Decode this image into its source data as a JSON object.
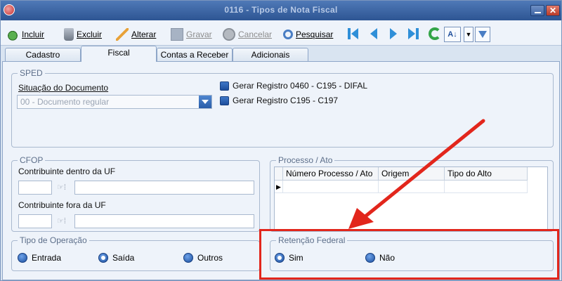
{
  "window": {
    "title": "0116 - Tipos de Nota Fiscal"
  },
  "toolbar": {
    "incluir": "Incluir",
    "excluir": "Excluir",
    "alterar": "Alterar",
    "gravar": "Gravar",
    "cancelar": "Cancelar",
    "pesquisar": "Pesquisar",
    "sort": "A↓"
  },
  "tabs": [
    "Cadastro",
    "Fiscal",
    "Contas a Receber",
    "Adicionais"
  ],
  "active_tab": "Fiscal",
  "sped": {
    "title": "SPED",
    "situacao_label": "Situação do Documento",
    "situacao_value": "00 - Documento regular",
    "check1": "Gerar Registro 0460 - C195 - DIFAL",
    "check2": "Gerar Registro C195 - C197"
  },
  "cfop": {
    "title": "CFOP",
    "dentro_label": "Contribuinte dentro da UF",
    "fora_label": "Contribuinte fora da UF"
  },
  "processo": {
    "title": "Processo / Ato",
    "columns": [
      "Número Processo / Ato",
      "Origem",
      "Tipo do Alto"
    ],
    "row_indicator": "▶"
  },
  "tipo_operacao": {
    "title": "Tipo de Operação",
    "options": [
      "Entrada",
      "Saída",
      "Outros"
    ],
    "selected": "Saída"
  },
  "retencao": {
    "title": "Retenção Federal",
    "options": [
      "Sim",
      "Não"
    ],
    "selected": "Sim"
  },
  "annotation": {
    "color": "#e2261c"
  }
}
